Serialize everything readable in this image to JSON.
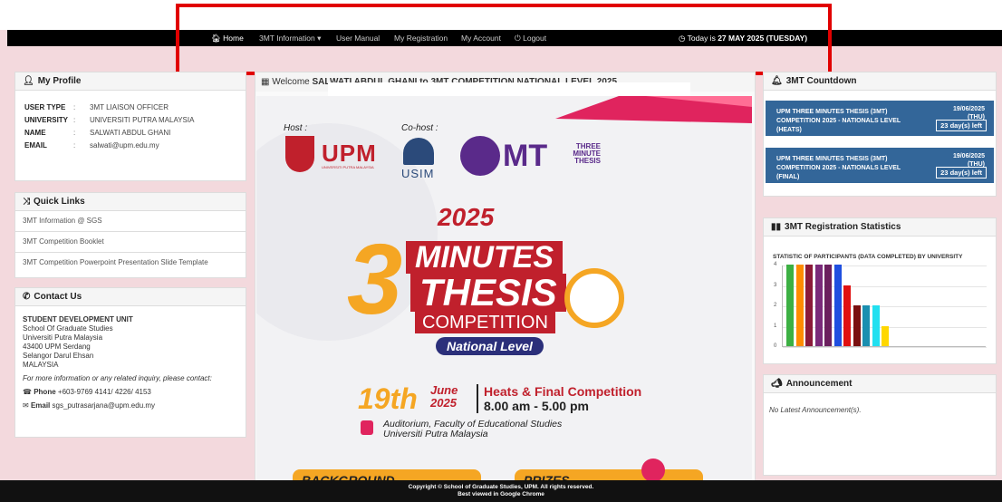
{
  "nav": {
    "home": "Home",
    "info": "3MT Information ▾",
    "manual": "User Manual",
    "registration": "My Registration",
    "account": "My Account",
    "logout": "Logout",
    "today_prefix": "Today is ",
    "today_date": "27 MAY 2025 (TUESDAY)"
  },
  "profile": {
    "title": "My Profile",
    "rows": [
      {
        "k": "USER TYPE",
        "v": "3MT LIAISON OFFICER"
      },
      {
        "k": "UNIVERSITY",
        "v": "UNIVERSITI PUTRA MALAYSIA"
      },
      {
        "k": "NAME",
        "v": "SALWATI ABDUL GHANI"
      },
      {
        "k": "EMAIL",
        "v": "salwati@upm.edu.my"
      }
    ]
  },
  "quick_links": {
    "title": "Quick Links",
    "items": [
      "3MT Information @ SGS",
      "3MT Competition Booklet",
      "3MT Competition Powerpoint Presentation Slide Template"
    ]
  },
  "contact": {
    "title": "Contact Us",
    "unit": "STUDENT DEVELOPMENT UNIT",
    "address": [
      "School Of Graduate Studies",
      "Universiti Putra Malaysia",
      "43400 UPM Serdang",
      "Selangor Darul Ehsan",
      "MALAYSIA"
    ],
    "note": "For more information or any related inquiry, please contact:",
    "phone_label": "Phone",
    "phone": "+603-9769 4141/ 4226/ 4153",
    "email_label": "Email",
    "email": "sgs_putrasarjana@upm.edu.my"
  },
  "welcome": {
    "prefix": "Welcome ",
    "name": "SALWATI ABDUL GHANI",
    "suffix": " to 3MT COMPETITION NATIONAL LEVEL 2025"
  },
  "poster": {
    "host": "Host :",
    "cohost": "Co-host :",
    "upm": "UPM",
    "upm_sub": "UNIVERSITI PUTRA MALAYSIA",
    "usim": "USIM",
    "mt": "MT",
    "three": "THREE",
    "minute": "MINUTE",
    "thesis_small": "THESIS",
    "year": "2025",
    "minutes": "MINUTES",
    "thesis": "THESIS",
    "competition": "COMPETITION",
    "national": "National Level",
    "day": "19th",
    "month": "June",
    "year2": "2025",
    "event": "Heats & Final Competition",
    "time": "8.00 am - 5.00 pm",
    "venue1": "Auditorium, Faculty of Educational Studies",
    "venue2": "Universiti Putra Malaysia",
    "background": "BACKGROUND",
    "prizes": "PRIZES"
  },
  "countdown": {
    "title": "3MT Countdown",
    "items": [
      {
        "name": "UPM THREE MINUTES THESIS (3MT) COMPETITION 2025 - NATIONALS LEVEL (HEATS)",
        "date": "19/06/2025",
        "day": "(THU)",
        "left": "23 day(s) left"
      },
      {
        "name": "UPM THREE MINUTES THESIS (3MT) COMPETITION 2025 - NATIONALS LEVEL (FINAL)",
        "date": "19/06/2025",
        "day": "(THU)",
        "left": "23 day(s) left"
      }
    ]
  },
  "stats": {
    "title": "3MT Registration Statistics"
  },
  "chart_data": {
    "type": "bar",
    "title": "STATISTIC OF PARTICIPANTS (DATA COMPLETED) BY UNIVERSITY",
    "ylim": [
      0,
      4
    ],
    "yticks": [
      "0",
      "1",
      "2",
      "3",
      "4"
    ],
    "values": [
      4,
      4,
      4,
      4,
      4,
      4,
      3,
      2,
      2,
      2,
      1
    ],
    "colors": [
      "#3cb043",
      "#ff8c00",
      "#8b1a3a",
      "#7a2a7a",
      "#6b1f5e",
      "#1f4fe0",
      "#e01010",
      "#7a1010",
      "#1a8fb0",
      "#22e0f0",
      "#ffd700"
    ]
  },
  "announcement": {
    "title": "Announcement",
    "text": "No Latest Announcement(s)."
  },
  "footer": {
    "line1": "Copyright © School of Graduate Studies, UPM. All rights reserved.",
    "line2_prefix": "Best viewed in ",
    "line2_browser": "Google Chrome"
  }
}
